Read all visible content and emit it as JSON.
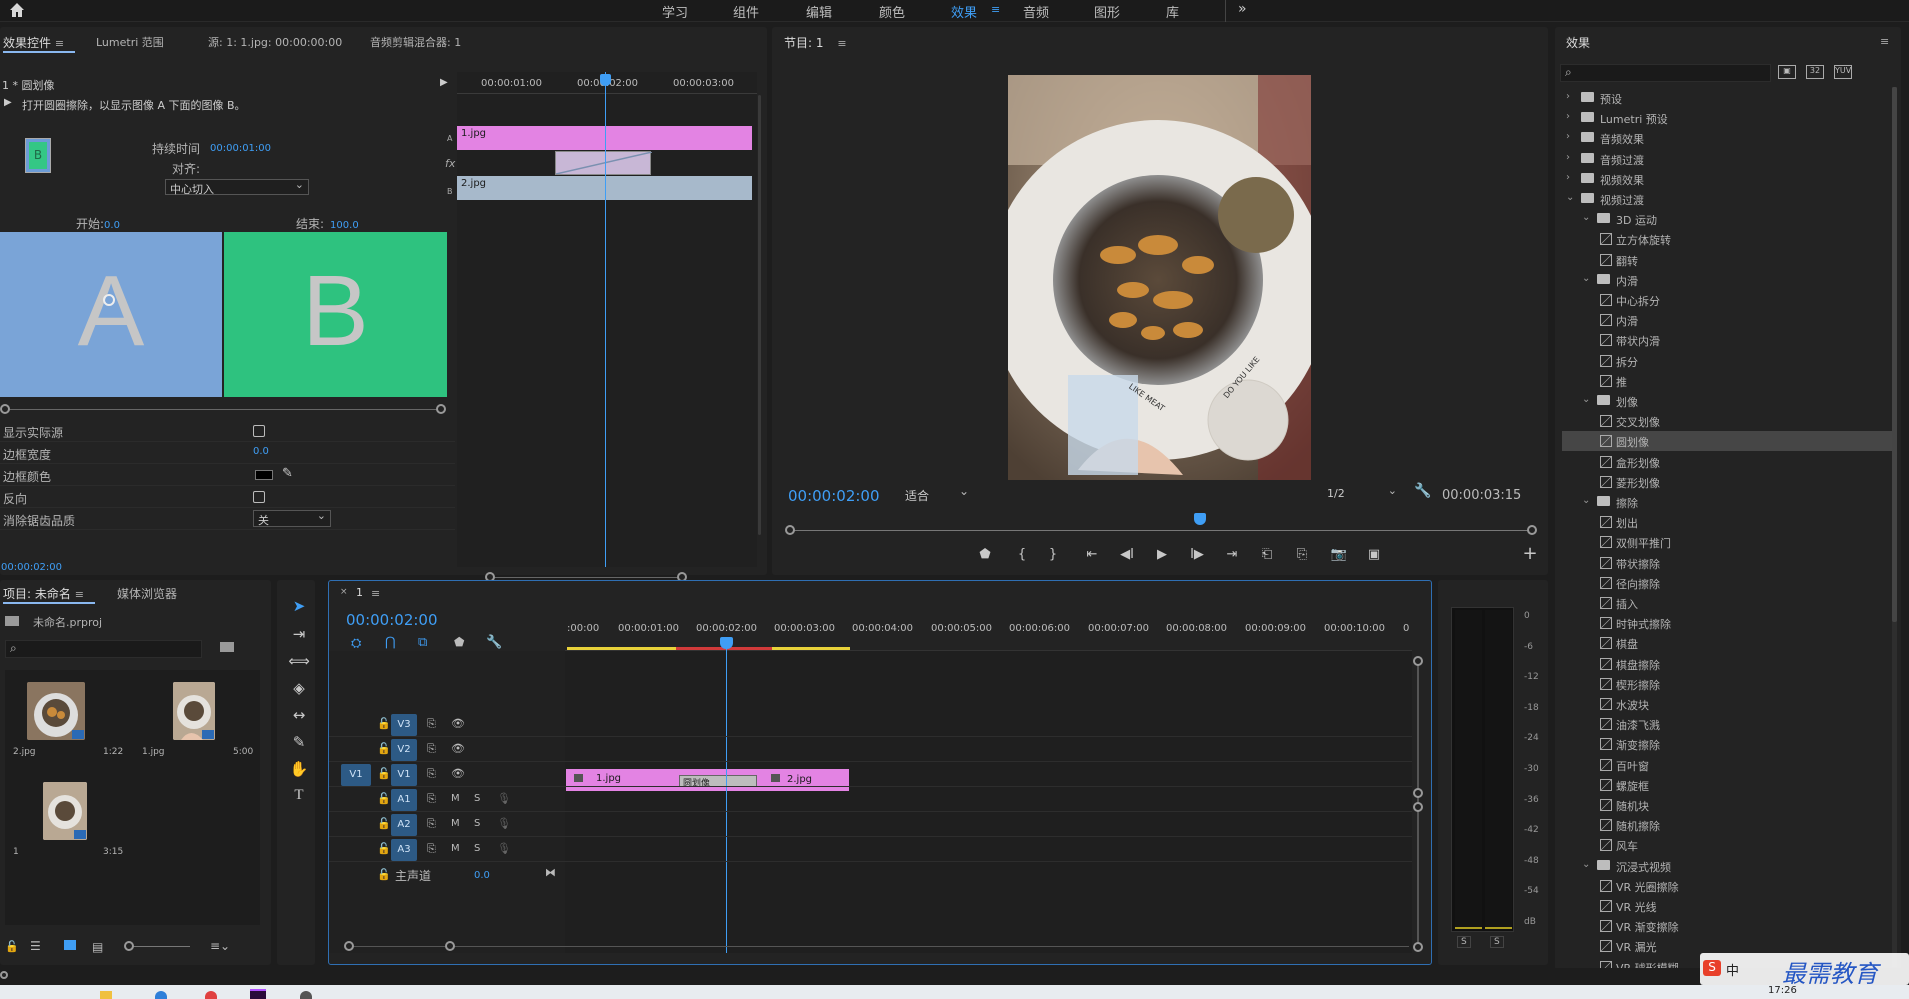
{
  "topbar": {
    "home_icon": "home-icon",
    "workspaces": [
      "学习",
      "组件",
      "编辑",
      "颜色",
      "效果",
      "音频",
      "图形",
      "库"
    ],
    "active_workspace": "效果",
    "more": "»"
  },
  "effect_controls": {
    "tabs": [
      "效果控件",
      "Lumetri 范围",
      "源: 1: 1.jpg: 00:00:00:00",
      "音频剪辑混合器: 1"
    ],
    "clip_title": "1 * 圆划像",
    "description": "打开圆圈擦除，以显示图像 A 下面的图像 B。",
    "duration_label": "持续时间",
    "duration_value": "00:00:01:00",
    "align_label": "对齐:",
    "align_value": "中心切入",
    "start_label": "开始:",
    "start_value": "0.0",
    "end_label": "结束:",
    "end_value": "100.0",
    "preview_a": "A",
    "preview_b": "B",
    "thumb_b": "B",
    "props": [
      {
        "label": "显示实际源",
        "type": "checkbox"
      },
      {
        "label": "边框宽度",
        "type": "value",
        "value": "0.0"
      },
      {
        "label": "边框颜色",
        "type": "color",
        "value": "#000000"
      },
      {
        "label": "反向",
        "type": "checkbox"
      },
      {
        "label": "消除锯齿品质",
        "type": "select",
        "value": "关"
      }
    ],
    "timecode": "00:00:02:00",
    "mini_timeline": {
      "ruler": [
        "00:00:01:00",
        "00:00:02:00",
        "00:00:03:00"
      ],
      "track_a": "A",
      "track_b": "B",
      "fx": "fx",
      "clip_a": "1.jpg",
      "clip_b": "2.jpg"
    }
  },
  "program": {
    "tab": "节目: 1",
    "timecode": "00:00:02:00",
    "fit": "适合",
    "resolution": "1/2",
    "duration": "00:00:03:15",
    "image_texts": [
      "LIKE MEAT",
      "DO YOU LIKE"
    ]
  },
  "effects": {
    "title": "效果",
    "search_placeholder": "",
    "tree": [
      {
        "level": 0,
        "kind": "folder",
        "label": "预设",
        "open": false
      },
      {
        "level": 0,
        "kind": "folder",
        "label": "Lumetri 预设",
        "open": false
      },
      {
        "level": 0,
        "kind": "folder",
        "label": "音频效果",
        "open": false
      },
      {
        "level": 0,
        "kind": "folder",
        "label": "音频过渡",
        "open": false
      },
      {
        "level": 0,
        "kind": "folder",
        "label": "视频效果",
        "open": false
      },
      {
        "level": 0,
        "kind": "folder",
        "label": "视频过渡",
        "open": true
      },
      {
        "level": 1,
        "kind": "folder",
        "label": "3D 运动",
        "open": true
      },
      {
        "level": 2,
        "kind": "fx",
        "label": "立方体旋转"
      },
      {
        "level": 2,
        "kind": "fx",
        "label": "翻转"
      },
      {
        "level": 1,
        "kind": "folder",
        "label": "内滑",
        "open": true
      },
      {
        "level": 2,
        "kind": "fx",
        "label": "中心拆分"
      },
      {
        "level": 2,
        "kind": "fx",
        "label": "内滑"
      },
      {
        "level": 2,
        "kind": "fx",
        "label": "带状内滑"
      },
      {
        "level": 2,
        "kind": "fx",
        "label": "拆分"
      },
      {
        "level": 2,
        "kind": "fx",
        "label": "推"
      },
      {
        "level": 1,
        "kind": "folder",
        "label": "划像",
        "open": true
      },
      {
        "level": 2,
        "kind": "fx",
        "label": "交叉划像"
      },
      {
        "level": 2,
        "kind": "fx",
        "label": "圆划像",
        "selected": true
      },
      {
        "level": 2,
        "kind": "fx",
        "label": "盒形划像"
      },
      {
        "level": 2,
        "kind": "fx",
        "label": "菱形划像"
      },
      {
        "level": 1,
        "kind": "folder",
        "label": "擦除",
        "open": true
      },
      {
        "level": 2,
        "kind": "fx",
        "label": "划出"
      },
      {
        "level": 2,
        "kind": "fx",
        "label": "双侧平推门"
      },
      {
        "level": 2,
        "kind": "fx",
        "label": "带状擦除"
      },
      {
        "level": 2,
        "kind": "fx",
        "label": "径向擦除"
      },
      {
        "level": 2,
        "kind": "fx",
        "label": "插入"
      },
      {
        "level": 2,
        "kind": "fx",
        "label": "时钟式擦除"
      },
      {
        "level": 2,
        "kind": "fx",
        "label": "棋盘"
      },
      {
        "level": 2,
        "kind": "fx",
        "label": "棋盘擦除"
      },
      {
        "level": 2,
        "kind": "fx",
        "label": "楔形擦除"
      },
      {
        "level": 2,
        "kind": "fx",
        "label": "水波块"
      },
      {
        "level": 2,
        "kind": "fx",
        "label": "油漆飞溅"
      },
      {
        "level": 2,
        "kind": "fx",
        "label": "渐变擦除"
      },
      {
        "level": 2,
        "kind": "fx",
        "label": "百叶窗"
      },
      {
        "level": 2,
        "kind": "fx",
        "label": "螺旋框"
      },
      {
        "level": 2,
        "kind": "fx",
        "label": "随机块"
      },
      {
        "level": 2,
        "kind": "fx",
        "label": "随机擦除"
      },
      {
        "level": 2,
        "kind": "fx",
        "label": "风车"
      },
      {
        "level": 1,
        "kind": "folder",
        "label": "沉浸式视频",
        "open": true
      },
      {
        "level": 2,
        "kind": "fx",
        "label": "VR 光圈擦除"
      },
      {
        "level": 2,
        "kind": "fx",
        "label": "VR 光线"
      },
      {
        "level": 2,
        "kind": "fx",
        "label": "VR 渐变擦除"
      },
      {
        "level": 2,
        "kind": "fx",
        "label": "VR 漏光"
      },
      {
        "level": 2,
        "kind": "fx",
        "label": "VR 球形模糊"
      }
    ]
  },
  "project": {
    "tabs": [
      "项目: 未命名",
      "媒体浏览器"
    ],
    "file": "未命名.prproj",
    "items": [
      {
        "name": "2.jpg",
        "duration": "1:22"
      },
      {
        "name": "1.jpg",
        "duration": "5:00"
      },
      {
        "name": "1",
        "duration": "3:15"
      }
    ]
  },
  "timeline": {
    "tab": "1",
    "timecode": "00:00:02:00",
    "ruler": [
      ":00:00",
      "00:00:01:00",
      "00:00:02:00",
      "00:00:03:00",
      "00:00:04:00",
      "00:00:05:00",
      "00:00:06:00",
      "00:00:07:00",
      "00:00:08:00",
      "00:00:09:00",
      "00:00:10:00",
      "0"
    ],
    "video_tracks": [
      "V3",
      "V2",
      "V1"
    ],
    "audio_tracks": [
      "A1",
      "A2",
      "A3"
    ],
    "source_patch": "V1",
    "mute": "M",
    "solo": "S",
    "master_label": "主声道",
    "master_value": "0.0",
    "clip1": "1.jpg",
    "transition": "圆划像",
    "clip2": "2.jpg"
  },
  "meter": {
    "labels": [
      "0",
      "-6",
      "-12",
      "-18",
      "-24",
      "-30",
      "-36",
      "-42",
      "-48",
      "-54",
      "dB"
    ],
    "solo": [
      "S",
      "S"
    ]
  },
  "watermark": {
    "text": "最需教育",
    "ime": "中"
  },
  "taskbar": {
    "time": "17:26"
  },
  "colors": {
    "accent": "#3f9ef5",
    "clip_pink": "#e383e3",
    "clip_blue": "#a7b9cb",
    "a_blue": "#7aa4d7",
    "b_green": "#2ec27f"
  }
}
